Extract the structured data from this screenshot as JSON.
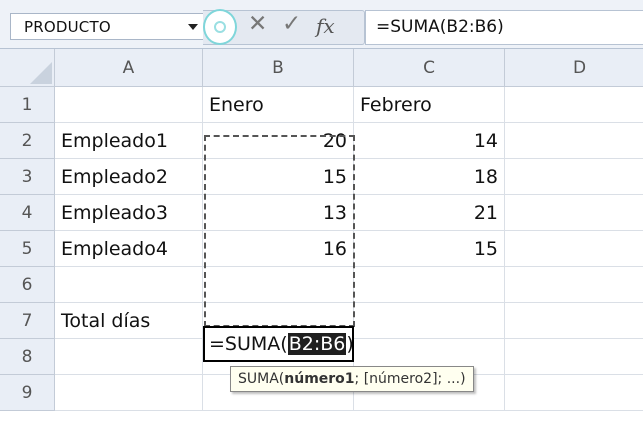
{
  "formula_bar": {
    "name_box": "PRODUCTO",
    "cancel_icon": "✕",
    "enter_icon": "✓",
    "fx_label": "fx",
    "formula": "=SUMA(B2:B6)"
  },
  "columns": [
    "A",
    "B",
    "C",
    "D"
  ],
  "rows": [
    {
      "num": "1",
      "A": "",
      "B": "Enero",
      "C": "Febrero",
      "D": ""
    },
    {
      "num": "2",
      "A": "Empleado1",
      "B": "20",
      "C": "14",
      "D": ""
    },
    {
      "num": "3",
      "A": "Empleado2",
      "B": "15",
      "C": "18",
      "D": ""
    },
    {
      "num": "4",
      "A": "Empleado3",
      "B": "13",
      "C": "21",
      "D": ""
    },
    {
      "num": "5",
      "A": "Empleado4",
      "B": "16",
      "C": "15",
      "D": ""
    },
    {
      "num": "6",
      "A": "",
      "B": "",
      "C": "",
      "D": ""
    },
    {
      "num": "7",
      "A": "Total días",
      "B": "",
      "C": "",
      "D": ""
    },
    {
      "num": "8",
      "A": "",
      "B": "",
      "C": "",
      "D": ""
    },
    {
      "num": "9",
      "A": "",
      "B": "",
      "C": "",
      "D": ""
    }
  ],
  "editing": {
    "prefix": "=SUMA(",
    "range": "B2:B6",
    "suffix": ")"
  },
  "tooltip": {
    "fn": "SUMA(",
    "arg1": "número1",
    "rest": "; [número2]; ...)"
  },
  "colors": {
    "header_bg": "#e9eef6",
    "formula_bar_bg": "#eef2f8",
    "selection": "#1f1f1f"
  }
}
